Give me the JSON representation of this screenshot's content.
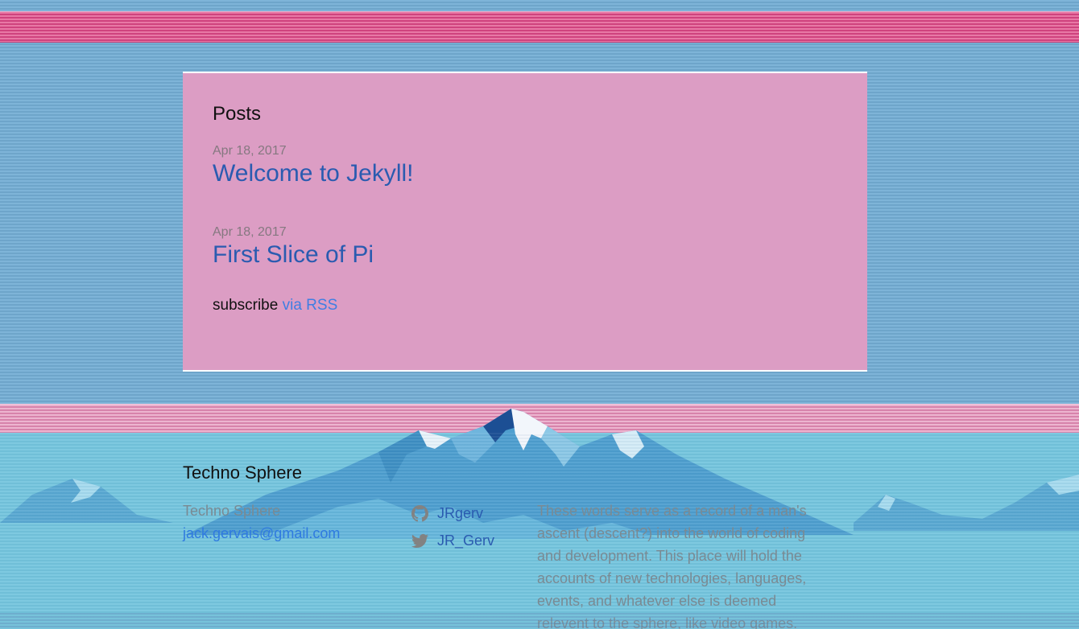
{
  "posts": {
    "heading": "Posts",
    "items": [
      {
        "date": "Apr 18, 2017",
        "title": "Welcome to Jekyll!"
      },
      {
        "date": "Apr 18, 2017",
        "title": "First Slice of Pi"
      }
    ],
    "subscribe_label": "subscribe",
    "subscribe_link": "via RSS"
  },
  "footer": {
    "heading": "Techno Sphere",
    "site_name": "Techno Sphere",
    "email": "jack.gervais@gmail.com",
    "social": [
      {
        "icon": "github-icon",
        "label": "JRgerv"
      },
      {
        "icon": "twitter-icon",
        "label": "JR_Gerv"
      }
    ],
    "description": "These words serve as a record of a man's ascent (descent?) into the world of coding and development. This place will hold the accounts of new technologies, languages, events, and whatever else is deemed relevent to the sphere, like video games."
  },
  "colors": {
    "sky": "#74aed5",
    "top_band": "#e2528c",
    "card": "#dc9dc4",
    "bottom_band": "#e597bd",
    "footer": "#76c6de",
    "link": "#2a5bb0",
    "muted_text": "#7a8a93"
  }
}
